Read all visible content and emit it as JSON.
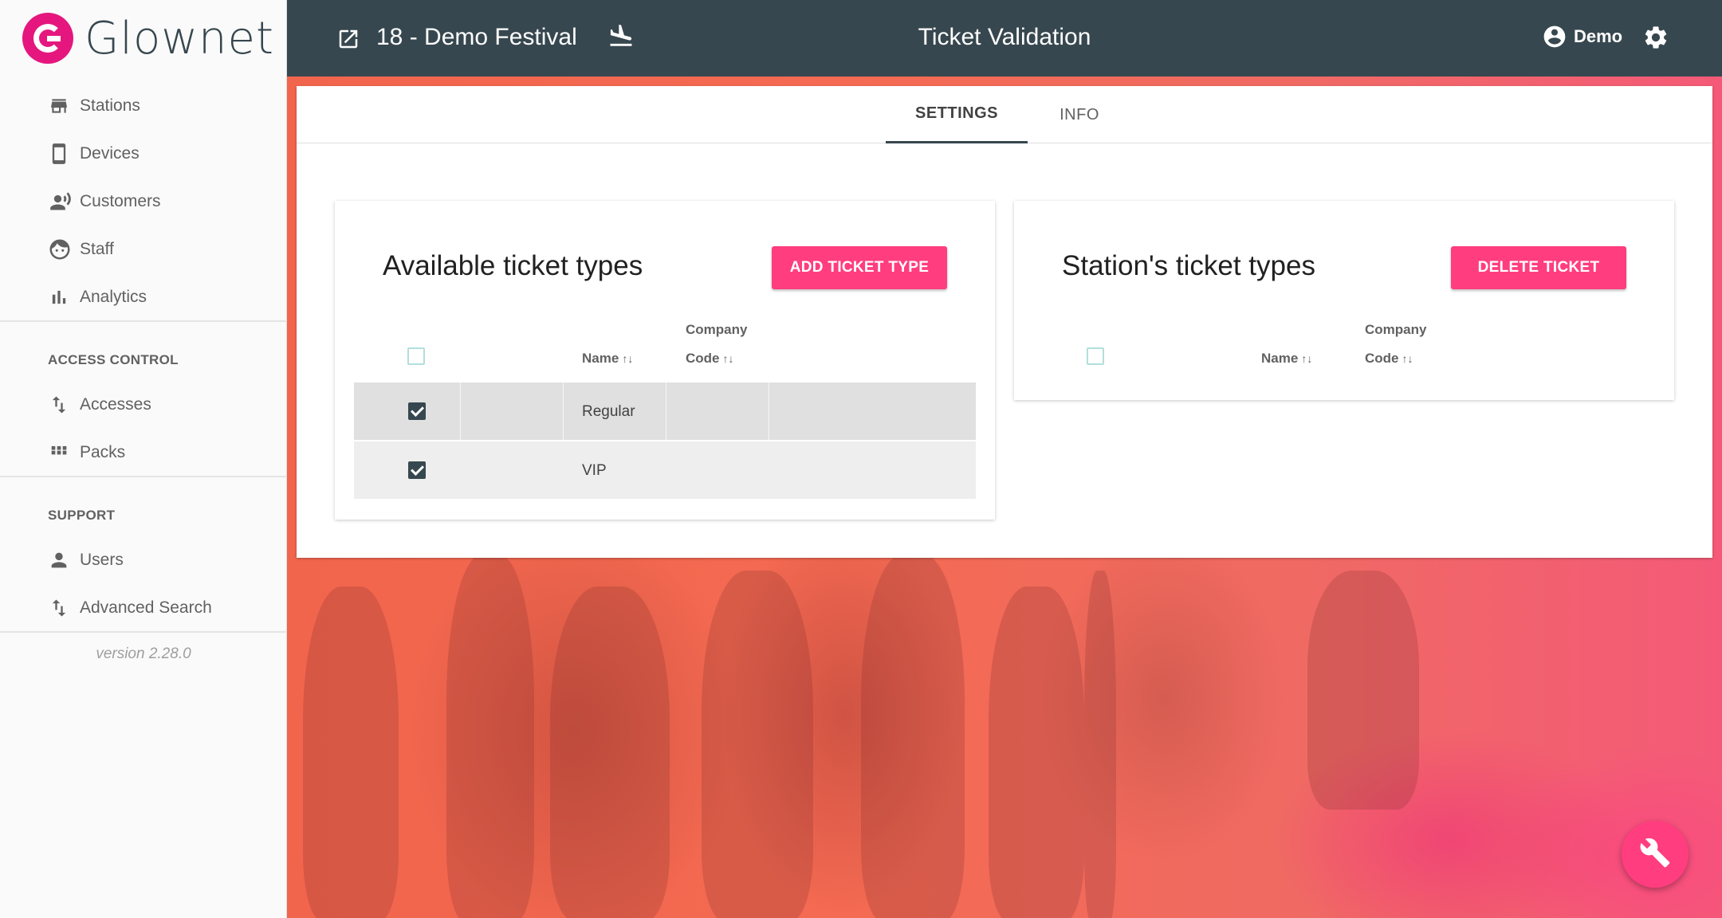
{
  "brand": {
    "name": "Glownet"
  },
  "sidebar": {
    "items": [
      {
        "label": "Stations",
        "icon": "store-icon"
      },
      {
        "label": "Devices",
        "icon": "smartphone-icon"
      },
      {
        "label": "Customers",
        "icon": "customers-voice-icon"
      },
      {
        "label": "Staff",
        "icon": "face-icon"
      },
      {
        "label": "Analytics",
        "icon": "bar-chart-icon"
      }
    ],
    "sections": [
      {
        "title": "ACCESS CONTROL",
        "items": [
          {
            "label": "Accesses",
            "icon": "swap-vertical-icon"
          },
          {
            "label": "Packs",
            "icon": "apps-grid-icon"
          }
        ]
      },
      {
        "title": "SUPPORT",
        "items": [
          {
            "label": "Users",
            "icon": "person-icon"
          },
          {
            "label": "Advanced Search",
            "icon": "swap-vertical-icon"
          }
        ]
      }
    ],
    "version": "version 2.28.0"
  },
  "header": {
    "event_name": "18 - Demo Festival",
    "page_title": "Ticket Validation",
    "user_name": "Demo"
  },
  "tabs": [
    {
      "label": "SETTINGS",
      "active": true
    },
    {
      "label": "INFO",
      "active": false
    }
  ],
  "available": {
    "title": "Available ticket types",
    "button": "ADD TICKET TYPE",
    "columns": {
      "name": "Name",
      "company_line1": "Company",
      "company_line2": "Code",
      "sort": "↑↓"
    },
    "rows": [
      {
        "name": "Regular",
        "checked": true
      },
      {
        "name": "VIP",
        "checked": true
      }
    ]
  },
  "station": {
    "title": "Station's ticket types",
    "button": "DELETE TICKET",
    "columns": {
      "name": "Name",
      "company_line1": "Company",
      "company_line2": "Code",
      "sort": "↑↓"
    },
    "rows": []
  },
  "colors": {
    "header": "#37474f",
    "accent": "#ff3d7f",
    "brand": "#e5177e"
  }
}
